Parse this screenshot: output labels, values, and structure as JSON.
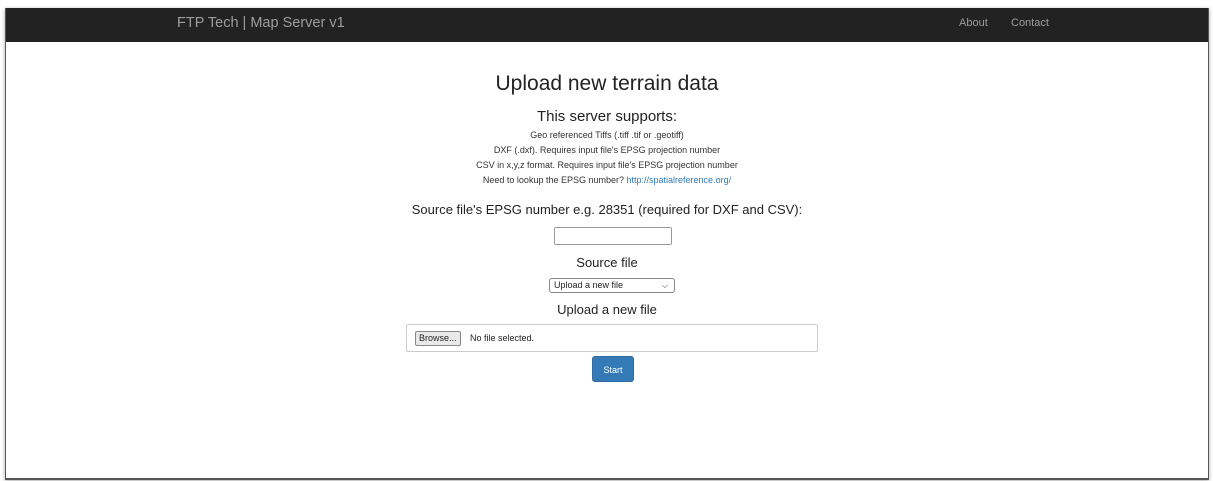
{
  "navbar": {
    "brand": "FTP Tech | Map Server v1",
    "links": [
      "About",
      "Contact"
    ]
  },
  "main": {
    "title": "Upload new terrain data",
    "supports_title": "This server supports:",
    "supports_lines": [
      "Geo referenced Tiffs (.tiff .tif or .geotiff)",
      "DXF (.dxf). Requires input file's EPSG projection number",
      "CSV in x,y,z format. Requires input file's EPSG projection number"
    ],
    "lookup_text": "Need to lookup the EPSG number?",
    "lookup_link": "http://spatialreference.org/",
    "epsg_label": "Source file's EPSG number e.g. 28351 (required for DXF and CSV):",
    "epsg_value": "",
    "source_label": "Source file",
    "source_selected": "Upload a new file",
    "upload_label": "Upload a new file",
    "browse_label": "Browse...",
    "file_status": "No file selected.",
    "start_label": "Start"
  },
  "colors": {
    "navbar_bg": "#222222",
    "navbar_text": "#9d9d9d",
    "link": "#337ab7",
    "primary_button": "#337ab7"
  },
  "icons": {
    "select_chevron": "chevron-down-icon"
  }
}
